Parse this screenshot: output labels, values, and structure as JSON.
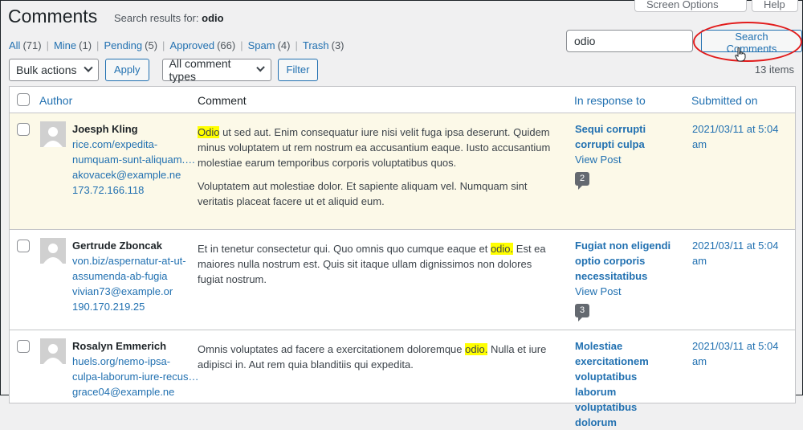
{
  "header": {
    "title": "Comments",
    "subtitle_prefix": "Search results for:",
    "search_term": "odio",
    "screen_options_label": "Screen Options",
    "help_label": "Help"
  },
  "filters": [
    {
      "label": "All",
      "count": "(71)"
    },
    {
      "label": "Mine",
      "count": "(1)"
    },
    {
      "label": "Pending",
      "count": "(5)"
    },
    {
      "label": "Approved",
      "count": "(66)"
    },
    {
      "label": "Spam",
      "count": "(4)"
    },
    {
      "label": "Trash",
      "count": "(3)"
    }
  ],
  "search": {
    "value": "odio",
    "button_label": "Search Comments"
  },
  "toolbar": {
    "bulk_label": "Bulk actions",
    "apply_label": "Apply",
    "types_label": "All comment types",
    "filter_label": "Filter",
    "items_count": "13 items"
  },
  "columns": {
    "author": "Author",
    "comment": "Comment",
    "response": "In response to",
    "submitted": "Submitted on"
  },
  "rows": [
    {
      "author": "Joesph Kling",
      "url": "rice.com/expedita-",
      "url2": "numquam-sunt-aliquam.htm",
      "email": "akovacek@example.ne",
      "ip": "173.72.166.118",
      "p1_before": "",
      "p1_highlight": "Odio",
      "p1_after": " ut sed aut. Enim consequatur iure nisi velit fuga ipsa deserunt. Quidem minus voluptatem ut rem nostrum ea accusantium eaque. Iusto accusantium molestiae earum temporibus corporis voluptatibus quos.",
      "p2": "Voluptatem aut molestiae dolor. Et sapiente aliquam vel. Numquam sint veritatis placeat facere ut et aliquid eum.",
      "post_title": "Sequi corrupti corrupti culpa",
      "view_post": "View Post",
      "comment_count": "2",
      "submitted": "2021/03/11 at 5:04 am"
    },
    {
      "author": "Gertrude Zboncak",
      "url": "von.biz/aspernatur-at-ut-",
      "url2": "assumenda-ab-fugia",
      "email": "vivian73@example.or",
      "ip": "190.170.219.25",
      "p1_before": "Et in tenetur consectetur qui. Quo omnis quo cumque eaque et ",
      "p1_highlight": "odio.",
      "p1_after": " Est ea maiores nulla nostrum est. Quis sit itaque ullam dignissimos non dolores fugiat nostrum.",
      "p2": "",
      "post_title": "Fugiat non eligendi optio corporis necessitatibus",
      "view_post": "View Post",
      "comment_count": "3",
      "submitted": "2021/03/11 at 5:04 am"
    },
    {
      "author": "Rosalyn Emmerich",
      "url": "huels.org/nemo-ipsa-",
      "url2": "culpa-laborum-iure-recusandae...",
      "email": "grace04@example.ne",
      "ip": "",
      "p1_before": "Omnis voluptates ad facere a exercitationem doloremque ",
      "p1_highlight": "odio.",
      "p1_after": " Nulla et iure adipisci in. Aut rem quia blanditiis qui expedita.",
      "p2": "",
      "post_title": "Molestiae exercitationem voluptatibus laborum voluptatibus dolorum",
      "view_post": "",
      "comment_count": "",
      "submitted": "2021/03/11 at 5:04 am"
    }
  ]
}
